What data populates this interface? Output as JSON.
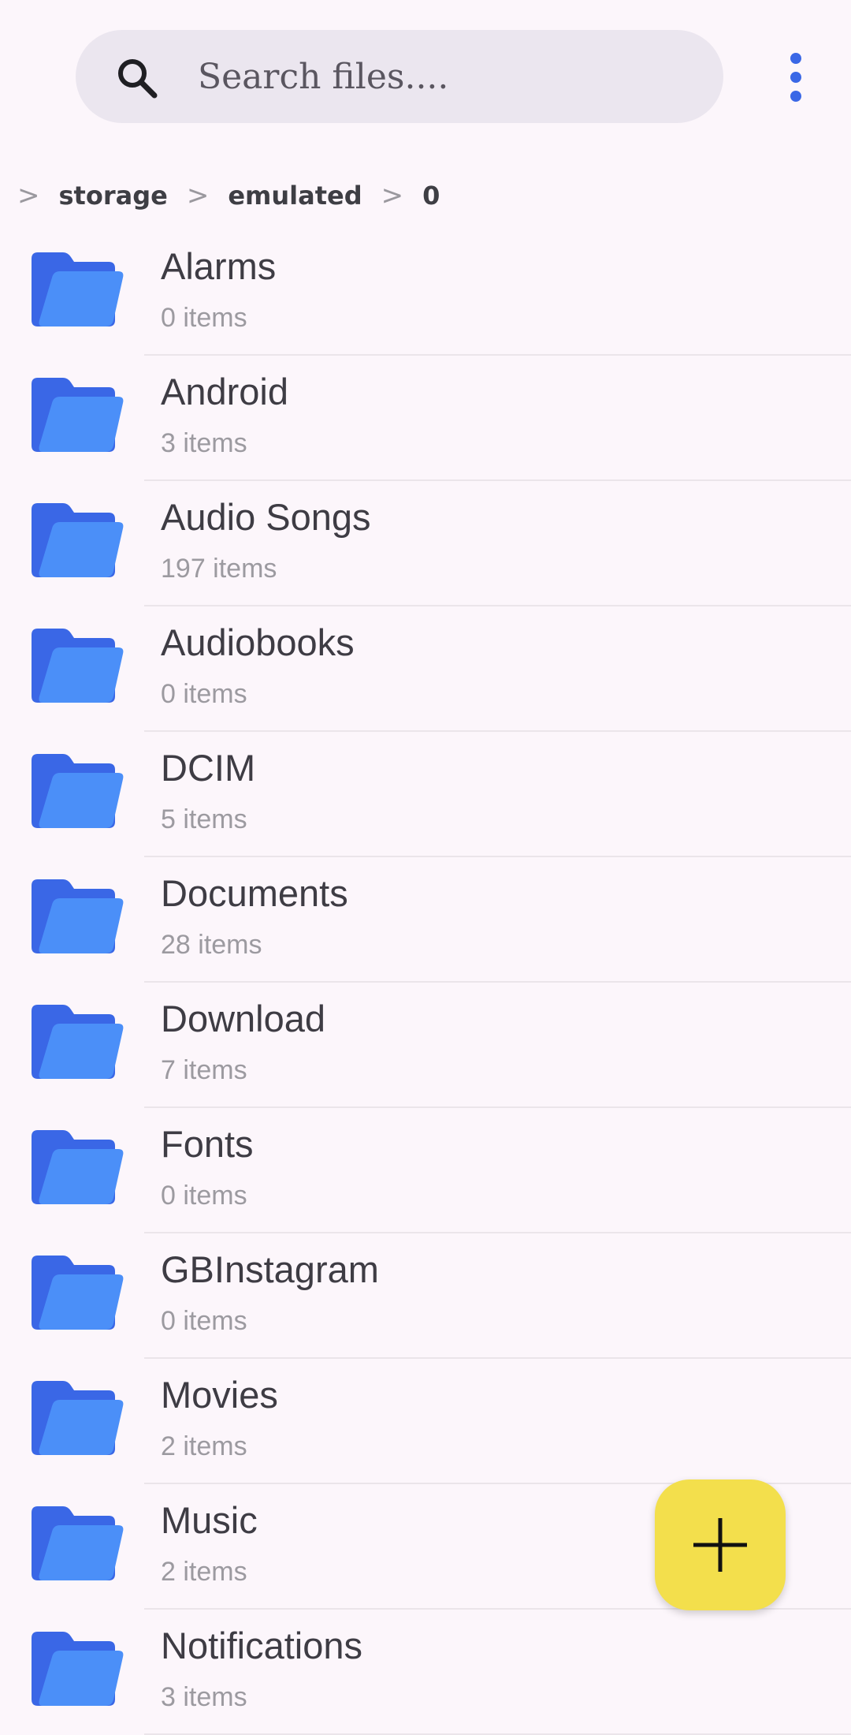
{
  "search": {
    "placeholder": "Search files...."
  },
  "menu": {
    "icon": "more-vert-icon"
  },
  "breadcrumb": {
    "separator": ">",
    "items": [
      "storage",
      "emulated",
      "0"
    ]
  },
  "files": [
    {
      "name": "Alarms",
      "count": "0 items"
    },
    {
      "name": "Android",
      "count": "3 items"
    },
    {
      "name": "Audio Songs",
      "count": "197 items"
    },
    {
      "name": "Audiobooks",
      "count": "0 items"
    },
    {
      "name": "DCIM",
      "count": "5 items"
    },
    {
      "name": "Documents",
      "count": "28 items"
    },
    {
      "name": "Download",
      "count": "7 items"
    },
    {
      "name": "Fonts",
      "count": "0 items"
    },
    {
      "name": "GBInstagram",
      "count": "0 items"
    },
    {
      "name": "Movies",
      "count": "2 items"
    },
    {
      "name": "Music",
      "count": "2 items"
    },
    {
      "name": "Notifications",
      "count": "3 items"
    }
  ],
  "colors": {
    "background": "#fcf6fb",
    "accent": "#3a67e6",
    "folder_back": "#3a67e6",
    "folder_front": "#4b8ff8",
    "fab": "#f3df4c"
  },
  "fab": {
    "icon": "plus-icon"
  }
}
